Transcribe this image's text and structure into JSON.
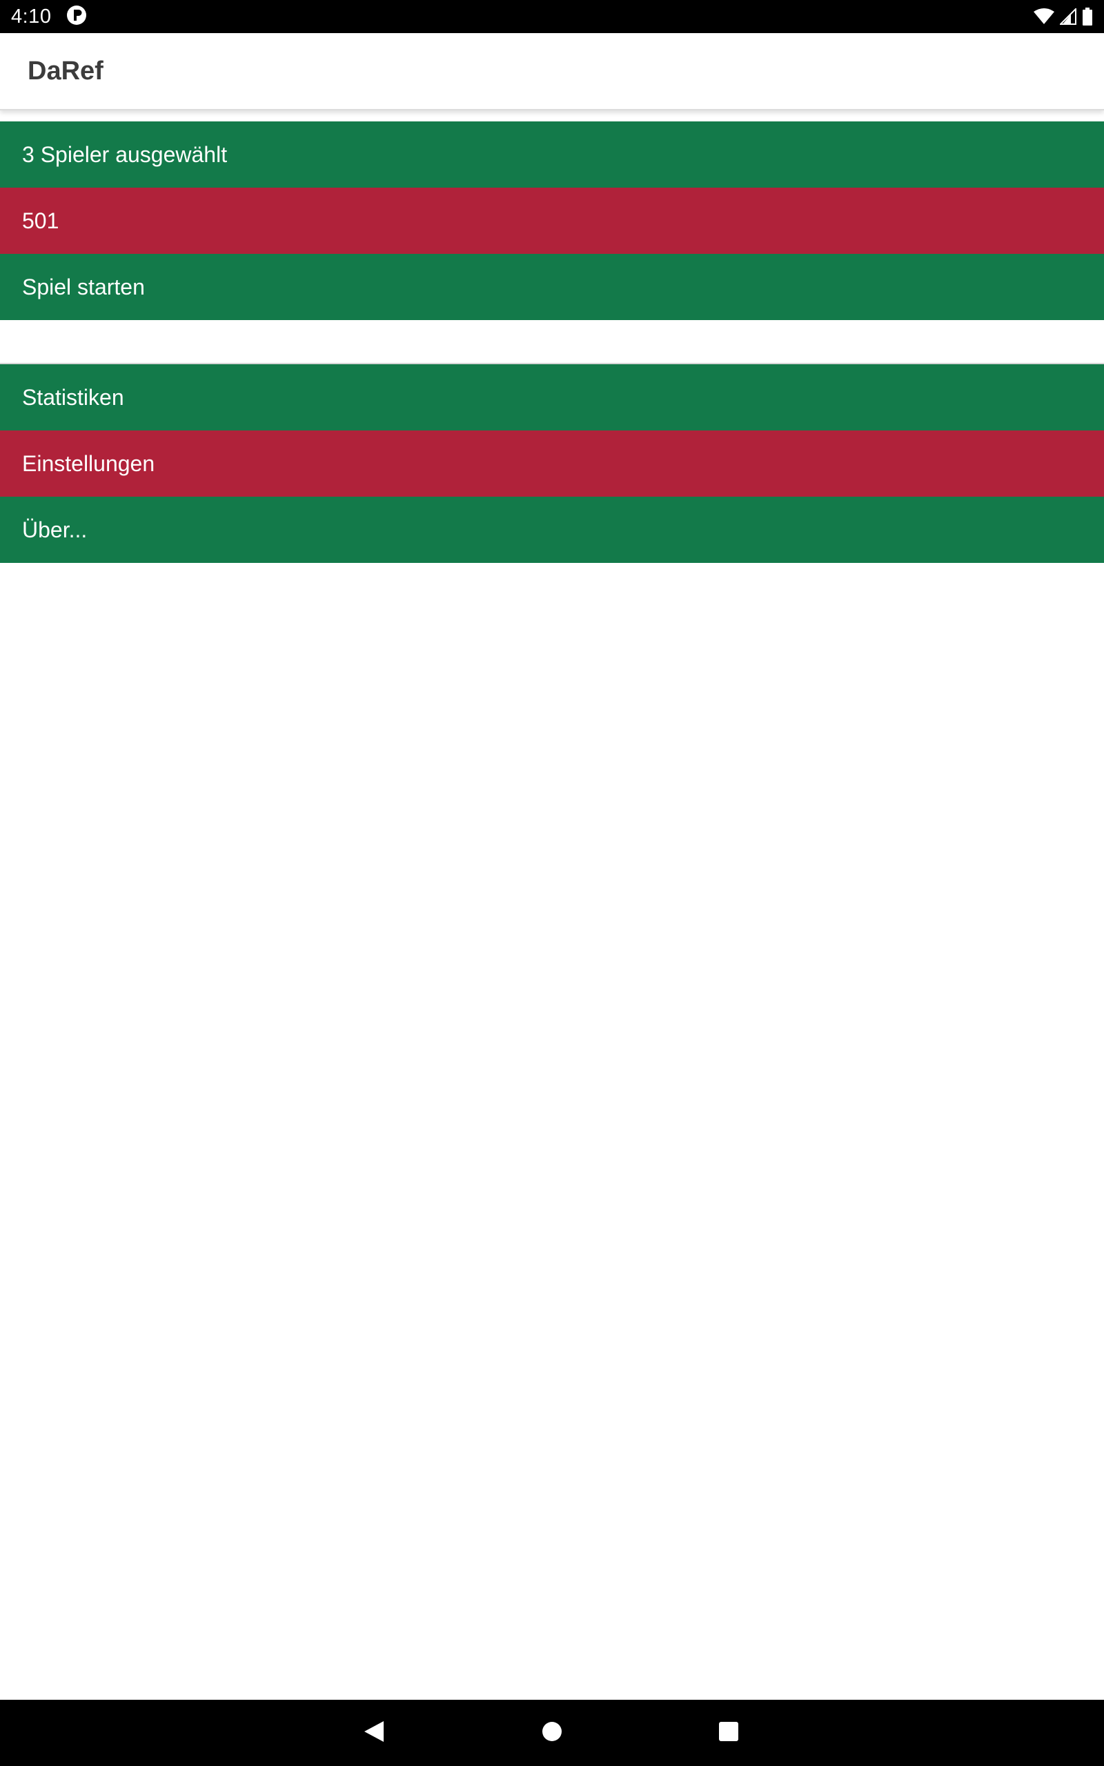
{
  "status_bar": {
    "time": "4:10",
    "icons": [
      "notification-p-icon",
      "wifi-icon",
      "signal-icon",
      "battery-icon"
    ]
  },
  "app_bar": {
    "title": "DaRef"
  },
  "menu": {
    "game_section": [
      {
        "label": "3 Spieler ausgewählt",
        "color": "#137a4a"
      },
      {
        "label": "501",
        "color": "#b0223a"
      },
      {
        "label": "Spiel starten",
        "color": "#137a4a"
      }
    ],
    "other_section": [
      {
        "label": "Statistiken",
        "color": "#137a4a"
      },
      {
        "label": "Einstellungen",
        "color": "#b0223a"
      },
      {
        "label": "Über...",
        "color": "#137a4a"
      }
    ]
  },
  "nav_bar": {
    "icons": [
      "back-icon",
      "home-icon",
      "recents-icon"
    ]
  },
  "colors": {
    "green": "#137a4a",
    "red": "#b0223a"
  }
}
